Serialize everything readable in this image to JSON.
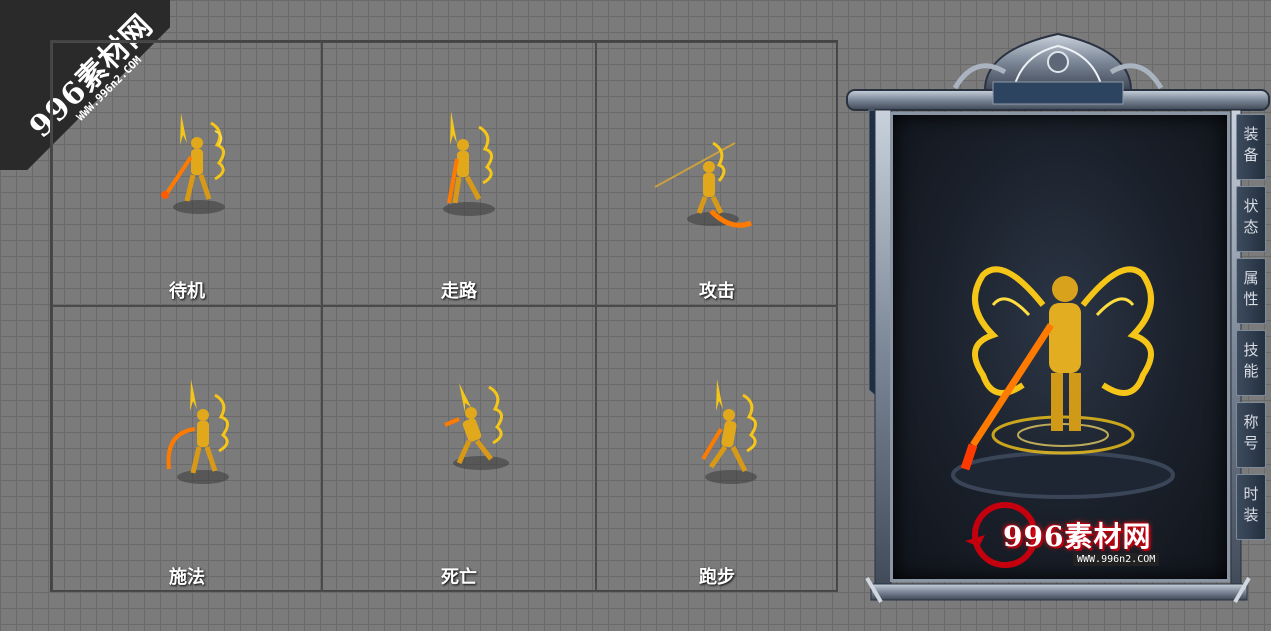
{
  "watermark": {
    "main": "996素材网",
    "sub": "WWW.996n2.COM"
  },
  "animations": [
    {
      "id": "idle",
      "label": "待机"
    },
    {
      "id": "walk",
      "label": "走路"
    },
    {
      "id": "attack",
      "label": "攻击"
    },
    {
      "id": "cast",
      "label": "施法"
    },
    {
      "id": "death",
      "label": "死亡"
    },
    {
      "id": "run",
      "label": "跑步"
    }
  ],
  "panel": {
    "tabs": [
      {
        "id": "equip",
        "label": "装备"
      },
      {
        "id": "status",
        "label": "状态"
      },
      {
        "id": "attributes",
        "label": "属性"
      },
      {
        "id": "skills",
        "label": "技能"
      },
      {
        "id": "title",
        "label": "称号"
      },
      {
        "id": "fashion",
        "label": "时装"
      }
    ],
    "logo": "996素材网",
    "logo_url": "WWW.996n2.COM"
  },
  "colors": {
    "background": "#7b7b7b",
    "gold": "#f5c518",
    "flame": "#ff7a00",
    "logo_red": "#b8000f"
  }
}
